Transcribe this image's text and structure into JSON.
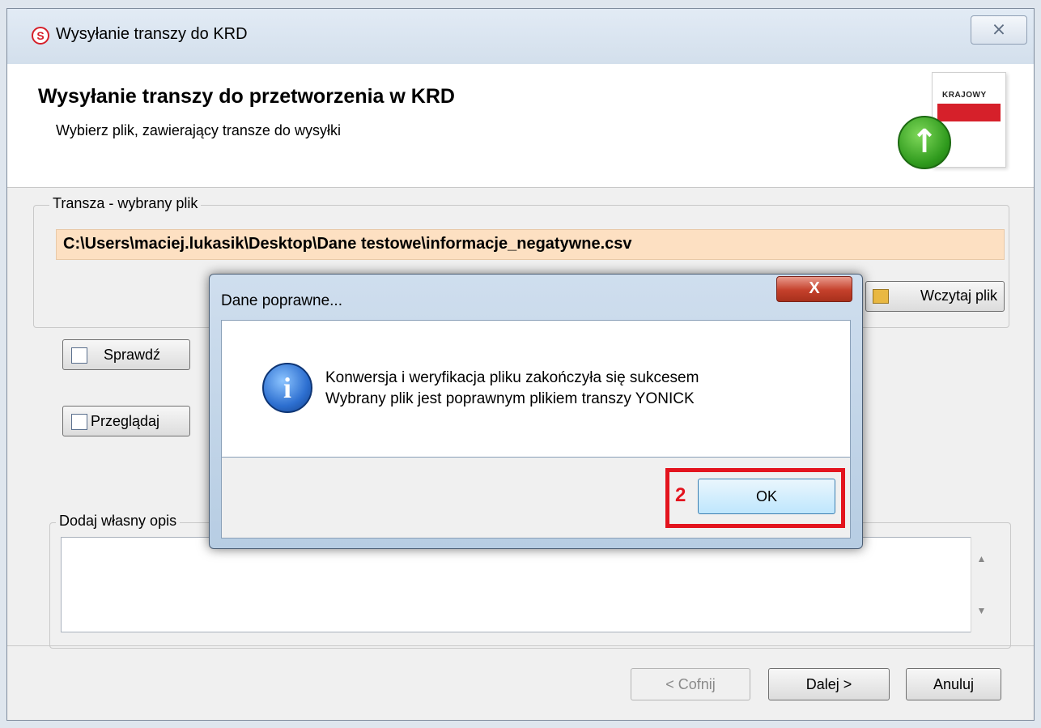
{
  "window": {
    "title": "Wysyłanie transzy do KRD",
    "close_glyph": "⨯"
  },
  "header": {
    "title": "Wysyłanie transzy do przetworzenia w KRD",
    "subtitle": "Wybierz plik, zawierający transze do wysyłki",
    "doc_label": "KRAJOWY"
  },
  "file_group": {
    "legend": "Transza - wybrany plik",
    "path": "C:\\Users\\maciej.lukasik\\Desktop\\Dane testowe\\informacje_negatywne.csv",
    "load_button": "Wczytaj plik"
  },
  "actions": {
    "check": "Sprawdź",
    "browse": "Przeglądaj"
  },
  "description_group": {
    "legend": "Dodaj własny opis"
  },
  "navigation": {
    "back": "< Cofnij",
    "next": "Dalej >",
    "cancel": "Anuluj"
  },
  "dialog": {
    "title": "Dane poprawne...",
    "close_glyph": "X",
    "message_line1": "Konwersja i weryfikacja pliku zakończyła się sukcesem",
    "message_line2": "Wybrany plik jest poprawnym plikiem transzy YONICK",
    "ok_button": "OK"
  },
  "annotation": {
    "step": "2",
    "color": "#e3141e"
  },
  "icons": {
    "app": "krd-logo-icon",
    "upload": "upload-arrow-icon",
    "info": "info-icon",
    "load": "folder-open-icon"
  }
}
